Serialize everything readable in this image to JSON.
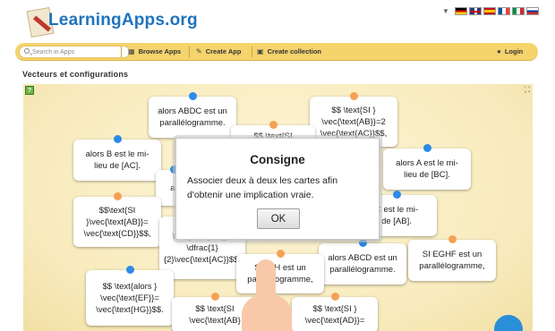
{
  "header": {
    "brand": "LearningApps.org",
    "flags": [
      "de",
      "uk",
      "es",
      "fr",
      "it",
      "ru"
    ]
  },
  "toolbar": {
    "search_placeholder": "Search in Apps",
    "browse_label": "Browse Apps",
    "create_label": "Create App",
    "collection_label": "Create collection",
    "login_label": "Login"
  },
  "page": {
    "title": "Vecteurs et configurations"
  },
  "cards": [
    {
      "text": "alors ABDC est un\nparallélogramme.",
      "dot": "blue"
    },
    {
      "text": "$$ \\text{SI }\n\\vec{\\text{AB}}=2\n\\vec{\\text{AC}}$$,",
      "dot": "orange"
    },
    {
      "text": "$$ \\text{SI",
      "dot": "orange"
    },
    {
      "text": "alors B est le mi-\nlieu de [AC].",
      "dot": "blue"
    },
    {
      "text": "alors A est le mi-\nlieu de [BC].",
      "dot": "blue"
    },
    {
      "text": "al",
      "dot": "blue"
    },
    {
      "text": "$$\\text{SI\n}\\vec{\\text{AB}}=\n\\vec{\\text{CD}}$$,",
      "dot": "orange"
    },
    {
      "text": "\\vec{\\text{BC}}=\n\\dfrac{1}\n{2}\\vec{\\text{AC}}$$,",
      "dot": "orange"
    },
    {
      "text": "C est le mi-\nde [AB].",
      "dot": "blue"
    },
    {
      "text": "SI EGHF est un\nparallélogramme,",
      "dot": "orange"
    },
    {
      "text": "alors ABCD est un\nparallélogramme.",
      "dot": "blue"
    },
    {
      "text": "S    FGH est un\nparallélogramme,",
      "dot": "orange"
    },
    {
      "text": "$$ \\text{alors }\n\\vec{\\text{EF}}=\n\\vec{\\text{HG}}$$.",
      "dot": "blue"
    },
    {
      "text": "$$ \\text{SI\n\\vec{\\text{AB}",
      "dot": "orange"
    },
    {
      "text": "$$ \\text{SI }\n\\vec{\\text{AD}}=",
      "dot": "orange"
    }
  ],
  "modal": {
    "title": "Consigne",
    "text": "Associer deux à deux les cartes afin d'obtenir une implication vraie.",
    "ok_label": "OK"
  },
  "colors": {
    "brand": "#1e73be",
    "toolbar": "#f5d36d",
    "dot_blue": "#2b8be6",
    "dot_orange": "#f5a155"
  }
}
